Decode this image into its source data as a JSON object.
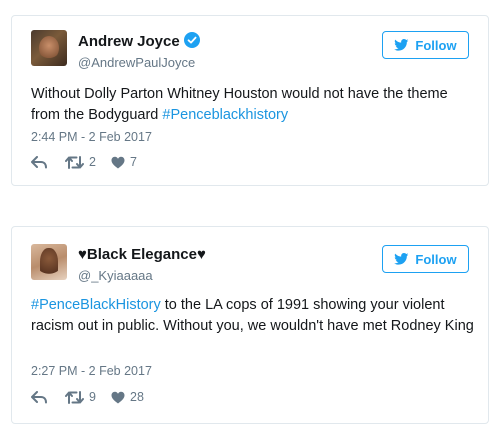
{
  "tweets": [
    {
      "name": "Andrew Joyce",
      "verified": true,
      "handle": "@AndrewPaulJoyce",
      "follow_label": "Follow",
      "text_before": "Without Dolly Parton Whitney Houston would not have the theme from the Bodyguard ",
      "hashtag": "#Penceblаckhistory",
      "text_after": "",
      "timestamp": "2:44 PM - 2 Feb 2017",
      "retweets": "2",
      "likes": "7"
    },
    {
      "name": "♥Black Elegance♥",
      "verified": false,
      "handle": "@_Kyiaaaaa",
      "follow_label": "Follow",
      "text_before": "",
      "hashtag": "#PenceBlackHistory",
      "text_after": " to the LA cops of 1991 showing your violent racism out in public. Without you, we wouldn't have met Rodney King",
      "timestamp": "2:27 PM - 2 Feb 2017",
      "retweets": "9",
      "likes": "28"
    }
  ],
  "icons": {
    "reply": "reply-icon",
    "retweet": "retweet-icon",
    "like": "heart-icon",
    "verified": "verified-badge-icon",
    "bird": "twitter-bird-icon"
  },
  "colors": {
    "accent": "#1da1f2",
    "hashtag": "#1b95e0",
    "muted": "#657786",
    "border": "#e1e8ed"
  }
}
